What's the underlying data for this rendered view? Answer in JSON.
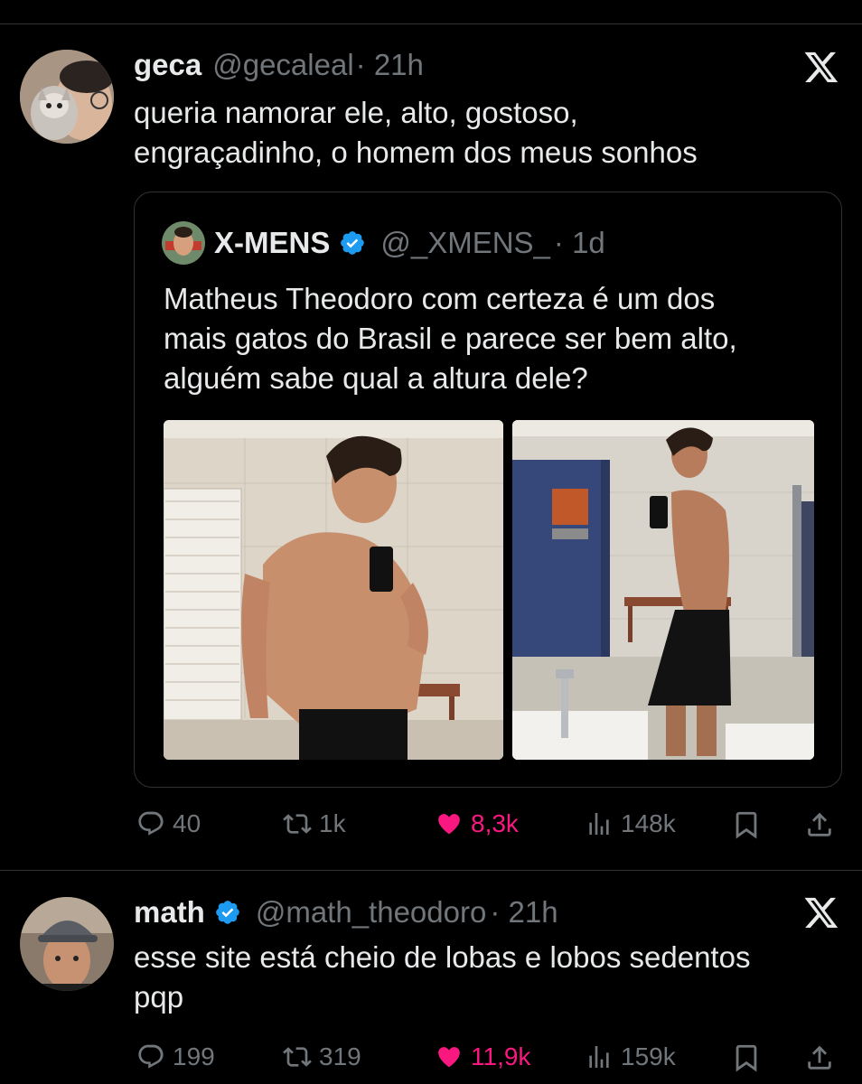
{
  "tweets": [
    {
      "display_name": "geca",
      "handle": "@gecaleal",
      "time": "· 21h",
      "text": "queria namorar ele, alto, gostoso,\nengraçadinho, o homem dos meus sonhos",
      "actions": {
        "replies": "40",
        "reposts": "1k",
        "likes": "8,3k",
        "views": "148k"
      }
    },
    {
      "display_name": "math",
      "handle": "@math_theodoro",
      "time": "· 21h",
      "text": "esse site está cheio de lobas e lobos sedentos\npqp",
      "actions": {
        "replies": "199",
        "reposts": "319",
        "likes": "11,9k",
        "views": "159k"
      }
    }
  ],
  "quote": {
    "display_name": "X-MENS",
    "handle": "@_XMENS_",
    "time": "· 1d",
    "text": "Matheus Theodoro com certeza é um dos\nmais gatos do Brasil e parece ser bem alto,\nalguém sabe qual a altura dele?"
  },
  "colors": {
    "background": "#000000",
    "text": "#e7e9ea",
    "muted": "#71767b",
    "like": "#f91880",
    "verified": "#1d9bf0",
    "border": "#2f3336"
  },
  "icons": [
    "x-logo-icon",
    "verified-icon",
    "reply-icon",
    "repost-icon",
    "like-icon",
    "views-icon",
    "bookmark-icon",
    "share-icon"
  ]
}
